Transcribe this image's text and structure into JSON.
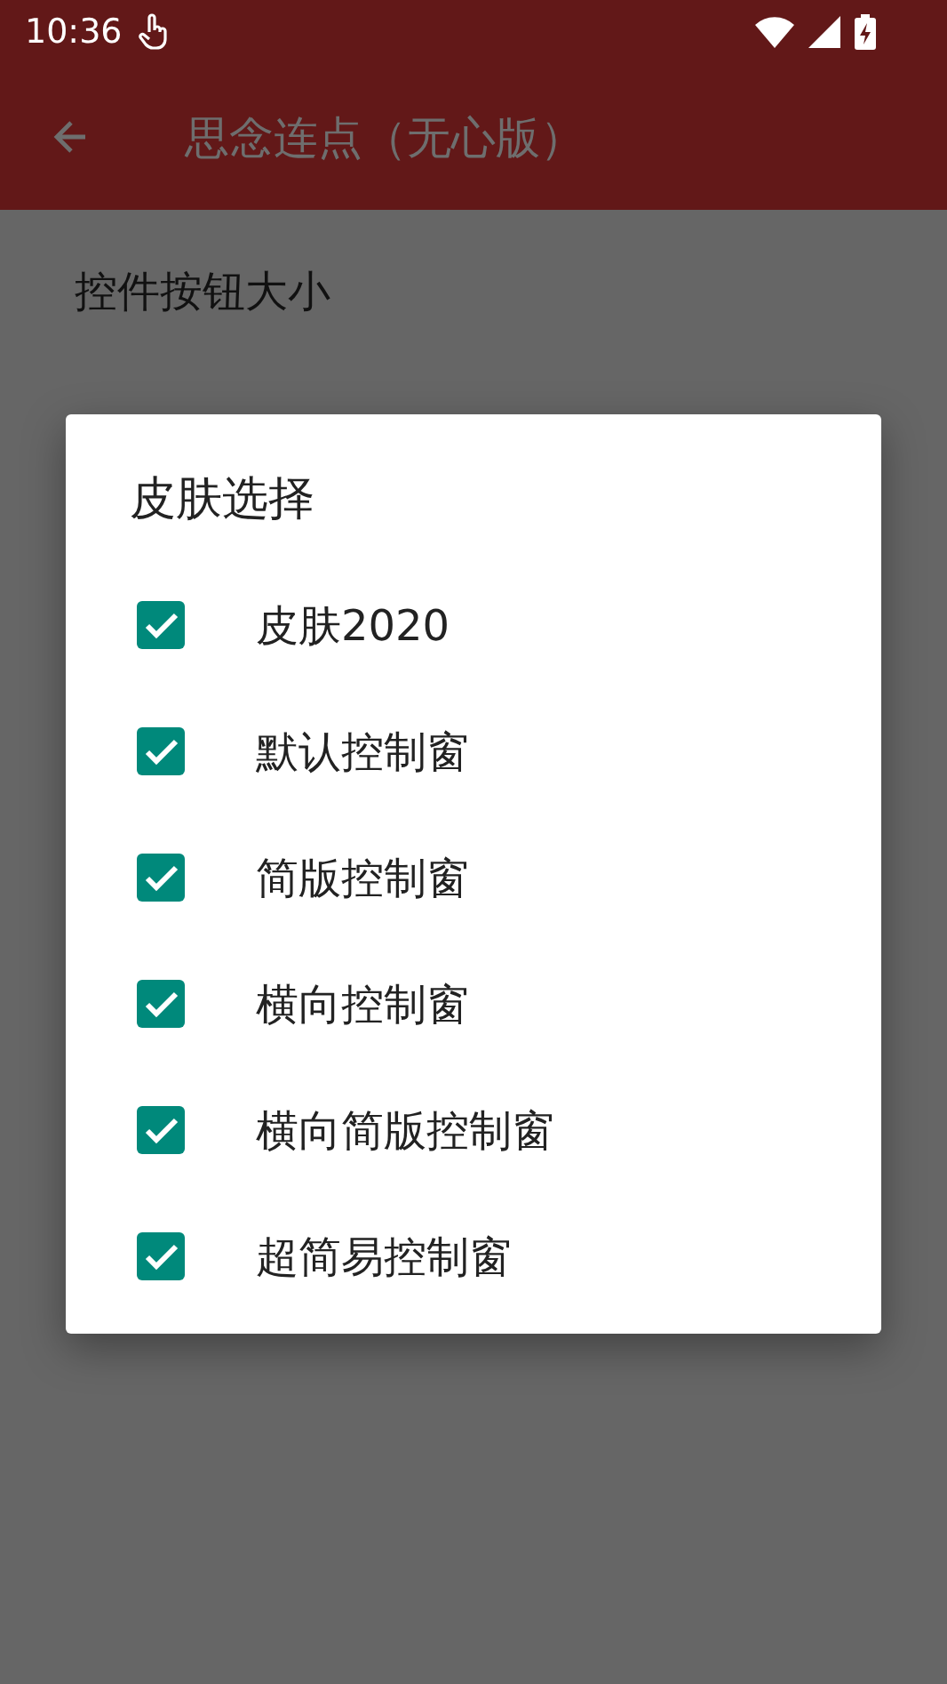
{
  "status_bar": {
    "time": "10:36"
  },
  "app_bar": {
    "title": "思念连点（无心版）"
  },
  "settings": [
    {
      "label": "控件按钮大小"
    }
  ],
  "dialog": {
    "title": "皮肤选择",
    "options": [
      {
        "label": "皮肤2020",
        "checked": true
      },
      {
        "label": "默认控制窗",
        "checked": true
      },
      {
        "label": "简版控制窗",
        "checked": true
      },
      {
        "label": "横向控制窗",
        "checked": true
      },
      {
        "label": "横向简版控制窗",
        "checked": true
      },
      {
        "label": "超简易控制窗",
        "checked": true
      }
    ]
  }
}
